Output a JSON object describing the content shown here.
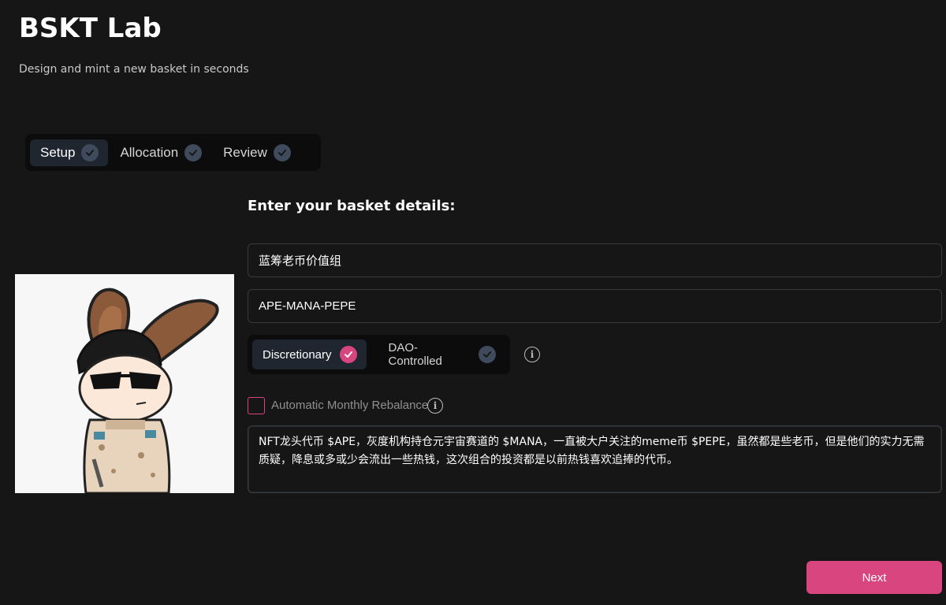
{
  "app": {
    "title": "BSKT Lab",
    "subtitle": "Design and mint a new basket in seconds"
  },
  "steps": [
    {
      "label": "Setup",
      "active": true,
      "icon": "check-icon"
    },
    {
      "label": "Allocation",
      "active": false,
      "icon": "check-icon"
    },
    {
      "label": "Review",
      "active": false,
      "icon": "check-icon"
    }
  ],
  "form": {
    "heading": "Enter your basket details:",
    "name_value": "蓝筹老币价值组",
    "symbol_value": "APE-MANA-PEPE",
    "management_options": [
      {
        "label": "Discretionary",
        "active": true,
        "icon": "check-icon"
      },
      {
        "label": "DAO-Controlled",
        "active": false,
        "icon": "check-icon"
      }
    ],
    "rebalance_label": "Automatic Monthly Rebalance",
    "rebalance_checked": false,
    "description_value": "NFT龙头代币 $APE，灰度机构持仓元宇宙赛道的 $MANA，一直被大户关注的meme币 $PEPE，虽然都是些老币，但是他们的实力无需质疑，降息或多或少会流出一些热钱，这次组合的投资都是以前热钱喜欢追捧的代币。",
    "next_label": "Next"
  },
  "colors": {
    "background": "#161616",
    "accent": "#d9457e",
    "active_tab": "#1f2630",
    "inactive_check": "#3f4a5c"
  }
}
